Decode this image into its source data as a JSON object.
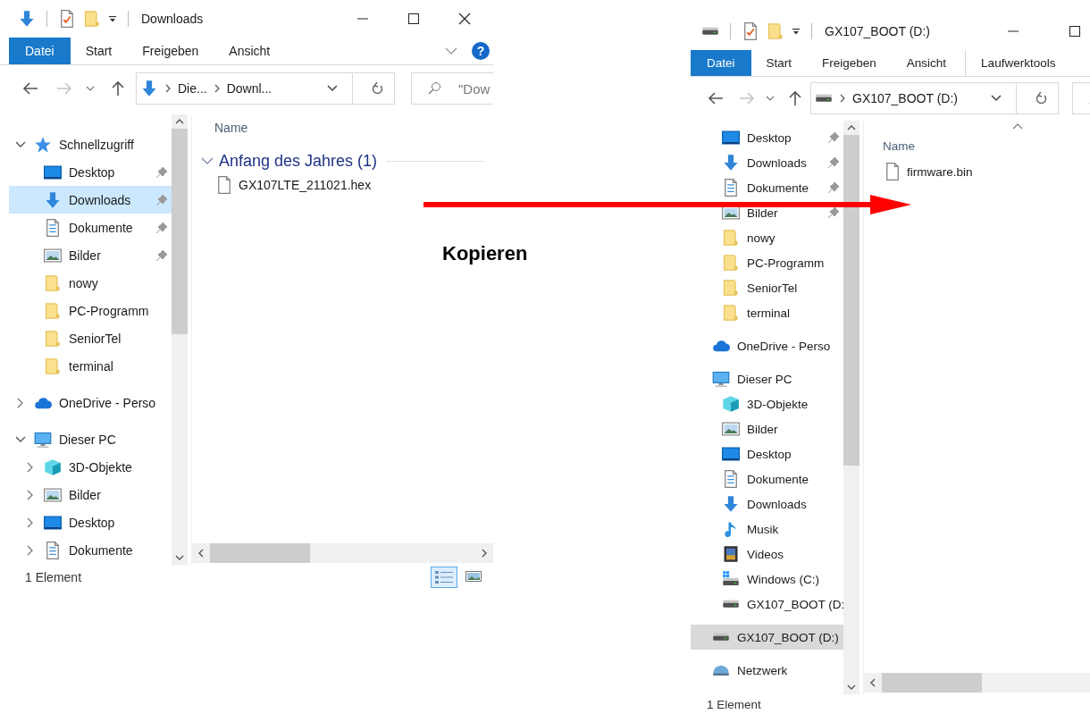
{
  "windows": [
    {
      "kind": "downloads",
      "title": "Downloads",
      "focused": true,
      "controls": [
        {
          "kind": "minimize"
        },
        {
          "kind": "maximize"
        },
        {
          "kind": "close"
        }
      ],
      "tabs": [
        {
          "label": "Datei",
          "selected": true,
          "contextual": false
        },
        {
          "label": "Start",
          "selected": false,
          "contextual": false
        },
        {
          "label": "Freigeben",
          "selected": false,
          "contextual": false
        },
        {
          "label": "Ansicht",
          "selected": false,
          "contextual": false
        }
      ],
      "help_button": {
        "label": "?"
      },
      "address": {
        "kind": "download",
        "segments": [
          "Die...",
          "Downl..."
        ]
      },
      "search": {
        "placeholder": "\"Dow"
      },
      "tree": [
        {
          "label": "Schnellzugriff",
          "kind": "star",
          "expanded": true,
          "selected": false,
          "children": [
            {
              "label": "Desktop",
              "kind": "desktop",
              "pinned": true,
              "selected": false
            },
            {
              "label": "Downloads",
              "kind": "download",
              "pinned": true,
              "selected": true
            },
            {
              "label": "Dokumente",
              "kind": "documents",
              "pinned": true,
              "selected": false
            },
            {
              "label": "Bilder",
              "kind": "pictures",
              "pinned": true,
              "selected": false
            },
            {
              "label": "nowy",
              "kind": "folder",
              "pinned": false,
              "selected": false
            },
            {
              "label": "PC-Programm",
              "kind": "folder",
              "pinned": false,
              "selected": false
            },
            {
              "label": "SeniorTel",
              "kind": "folder",
              "pinned": false,
              "selected": false
            },
            {
              "label": "terminal",
              "kind": "folder",
              "pinned": false,
              "selected": false
            }
          ]
        },
        {
          "label": "OneDrive - Perso",
          "kind": "cloud",
          "expanded": false,
          "selected": false
        },
        {
          "label": "Dieser PC",
          "kind": "pc",
          "expanded": true,
          "selected": false,
          "children": [
            {
              "label": "3D-Objekte",
              "kind": "cube",
              "expanded": false,
              "selected": false
            },
            {
              "label": "Bilder",
              "kind": "pictures",
              "expanded": false,
              "selected": false
            },
            {
              "label": "Desktop",
              "kind": "desktop",
              "expanded": false,
              "selected": false
            },
            {
              "label": "Dokumente",
              "kind": "documents",
              "expanded": false,
              "selected": false
            }
          ]
        }
      ],
      "column": {
        "label": "Name",
        "sorted": false
      },
      "groups": [
        {
          "label": "Anfang des Jahres (1)",
          "expanded": true,
          "files": [
            "GX107LTE_211021.hex"
          ]
        }
      ],
      "status": "1 Element",
      "views": [
        {
          "kind": "details",
          "selected": true
        },
        {
          "kind": "tiles",
          "selected": false
        }
      ]
    },
    {
      "kind": "drive",
      "title": "GX107_BOOT (D:)",
      "focused": false,
      "controls": [
        {
          "kind": "minimize"
        },
        {
          "kind": "maximize"
        }
      ],
      "tabs": [
        {
          "label": "Datei",
          "selected": true,
          "contextual": false
        },
        {
          "label": "Start",
          "selected": false,
          "contextual": false
        },
        {
          "label": "Freigeben",
          "selected": false,
          "contextual": false
        },
        {
          "label": "Ansicht",
          "selected": false,
          "contextual": false
        },
        {
          "label": "Laufwerktools",
          "selected": false,
          "contextual": true
        }
      ],
      "address": {
        "kind": "drive",
        "segments": [
          "GX107_BOOT (D:)"
        ]
      },
      "tree": [
        {
          "children": [
            {
              "label": "Desktop",
              "kind": "desktop",
              "pinned": true,
              "selected": false
            },
            {
              "label": "Downloads",
              "kind": "download",
              "pinned": true,
              "selected": false
            },
            {
              "label": "Dokumente",
              "kind": "documents",
              "pinned": true,
              "selected": false
            },
            {
              "label": "Bilder",
              "kind": "pictures",
              "pinned": true,
              "selected": false
            },
            {
              "label": "nowy",
              "kind": "folder",
              "pinned": false,
              "selected": false
            },
            {
              "label": "PC-Programm",
              "kind": "folder",
              "pinned": false,
              "selected": false
            },
            {
              "label": "SeniorTel",
              "kind": "folder",
              "pinned": false,
              "selected": false
            },
            {
              "label": "terminal",
              "kind": "folder",
              "pinned": false,
              "selected": false
            }
          ]
        },
        {
          "label": "OneDrive - Perso",
          "kind": "cloud",
          "selected": false
        },
        {
          "label": "Dieser PC",
          "kind": "pc",
          "selected": false,
          "children": [
            {
              "label": "3D-Objekte",
              "kind": "cube",
              "selected": false
            },
            {
              "label": "Bilder",
              "kind": "pictures",
              "selected": false
            },
            {
              "label": "Desktop",
              "kind": "desktop",
              "selected": false
            },
            {
              "label": "Dokumente",
              "kind": "documents",
              "selected": false
            },
            {
              "label": "Downloads",
              "kind": "download",
              "selected": false
            },
            {
              "label": "Musik",
              "kind": "music",
              "selected": false
            },
            {
              "label": "Videos",
              "kind": "videos",
              "selected": false
            },
            {
              "label": "Windows (C:)",
              "kind": "drive_windows",
              "selected": false
            },
            {
              "label": "GX107_BOOT (D:",
              "kind": "drive",
              "selected": false
            }
          ]
        },
        {
          "label": "GX107_BOOT (D:)",
          "kind": "drive",
          "selected": true
        },
        {
          "label": "Netzwerk",
          "kind": "network",
          "selected": false
        }
      ],
      "column": {
        "label": "Name",
        "sorted": true
      },
      "files": [
        "firmware.bin"
      ],
      "status": "1 Element"
    }
  ],
  "annotation": {
    "label": "Kopieren"
  }
}
